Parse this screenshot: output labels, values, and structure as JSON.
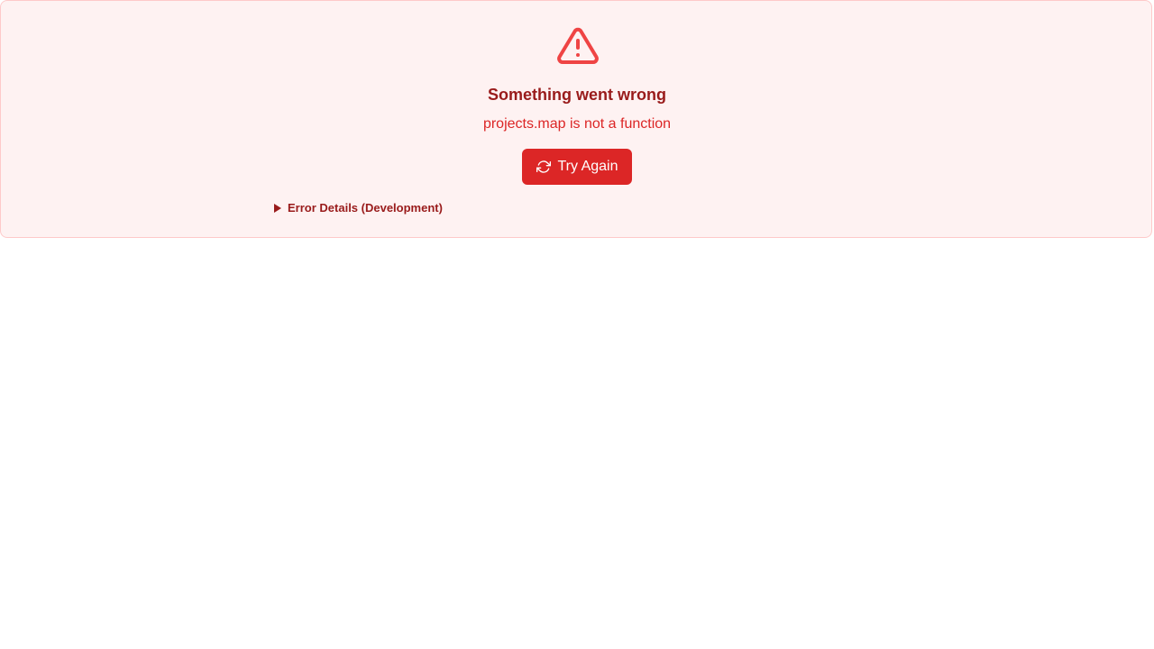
{
  "error": {
    "icon": "alert-triangle-icon",
    "title": "Something went wrong",
    "message": "projects.map is not a function",
    "retry_button": {
      "label": "Try Again",
      "icon": "refresh-icon"
    },
    "details_toggle": {
      "label": "Error Details (Development)",
      "icon": "caret-right-icon",
      "expanded": false
    }
  },
  "colors": {
    "panel_background": "#fef2f2",
    "panel_border": "#fecaca",
    "title": "#991b1b",
    "message": "#dc2626",
    "icon": "#ef4444",
    "button_background": "#dc2626",
    "button_text": "#ffffff"
  }
}
